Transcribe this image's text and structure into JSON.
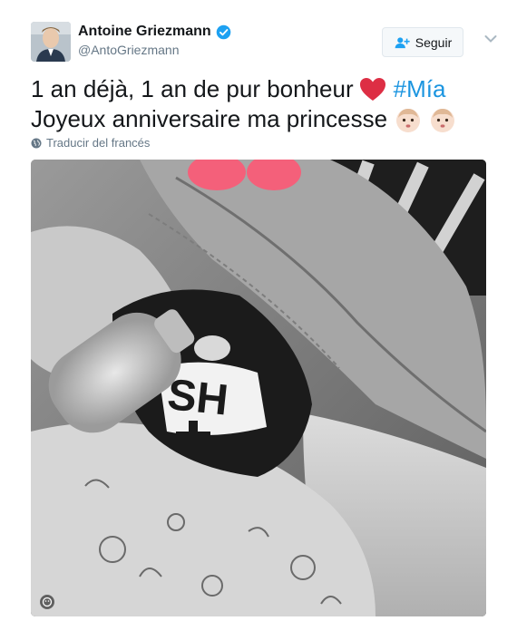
{
  "user": {
    "display_name": "Antoine Griezmann",
    "handle": "@AntoGriezmann",
    "verified": true,
    "avatar_icon": "profile-photo"
  },
  "follow_button": {
    "label": "Seguir",
    "icon": "add-user-icon"
  },
  "tweet": {
    "line1_text": "1 an déjà, 1 an de pur bonheur",
    "heart_icon": "red-heart-emoji",
    "hashtag": "#Mía",
    "line2_text": "Joyeux anniversaire ma princesse",
    "emojis": [
      "baby-emoji",
      "baby-emoji"
    ]
  },
  "translate": {
    "label": "Traducir del francés",
    "icon": "globe-icon"
  },
  "media": {
    "description_icon": "photo",
    "tag_icon": "face-icon"
  },
  "colors": {
    "accent": "#1b95e0",
    "verified": "#1da1f2",
    "heart": "#e0245e",
    "secondary_text": "#657786"
  }
}
